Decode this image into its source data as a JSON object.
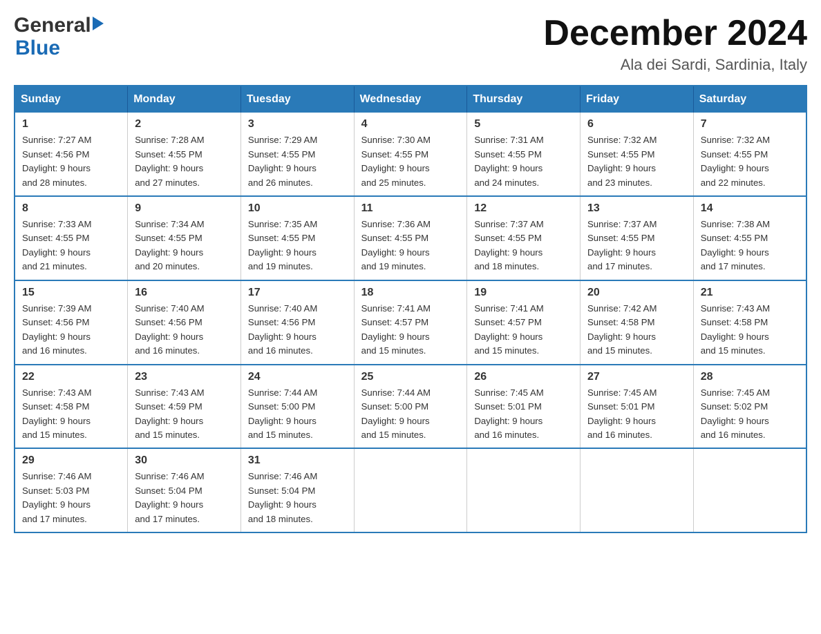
{
  "logo": {
    "general": "General",
    "blue": "Blue"
  },
  "title": "December 2024",
  "location": "Ala dei Sardi, Sardinia, Italy",
  "days_of_week": [
    "Sunday",
    "Monday",
    "Tuesday",
    "Wednesday",
    "Thursday",
    "Friday",
    "Saturday"
  ],
  "weeks": [
    [
      {
        "day": "1",
        "sunrise": "7:27 AM",
        "sunset": "4:56 PM",
        "daylight": "9 hours and 28 minutes."
      },
      {
        "day": "2",
        "sunrise": "7:28 AM",
        "sunset": "4:55 PM",
        "daylight": "9 hours and 27 minutes."
      },
      {
        "day": "3",
        "sunrise": "7:29 AM",
        "sunset": "4:55 PM",
        "daylight": "9 hours and 26 minutes."
      },
      {
        "day": "4",
        "sunrise": "7:30 AM",
        "sunset": "4:55 PM",
        "daylight": "9 hours and 25 minutes."
      },
      {
        "day": "5",
        "sunrise": "7:31 AM",
        "sunset": "4:55 PM",
        "daylight": "9 hours and 24 minutes."
      },
      {
        "day": "6",
        "sunrise": "7:32 AM",
        "sunset": "4:55 PM",
        "daylight": "9 hours and 23 minutes."
      },
      {
        "day": "7",
        "sunrise": "7:32 AM",
        "sunset": "4:55 PM",
        "daylight": "9 hours and 22 minutes."
      }
    ],
    [
      {
        "day": "8",
        "sunrise": "7:33 AM",
        "sunset": "4:55 PM",
        "daylight": "9 hours and 21 minutes."
      },
      {
        "day": "9",
        "sunrise": "7:34 AM",
        "sunset": "4:55 PM",
        "daylight": "9 hours and 20 minutes."
      },
      {
        "day": "10",
        "sunrise": "7:35 AM",
        "sunset": "4:55 PM",
        "daylight": "9 hours and 19 minutes."
      },
      {
        "day": "11",
        "sunrise": "7:36 AM",
        "sunset": "4:55 PM",
        "daylight": "9 hours and 19 minutes."
      },
      {
        "day": "12",
        "sunrise": "7:37 AM",
        "sunset": "4:55 PM",
        "daylight": "9 hours and 18 minutes."
      },
      {
        "day": "13",
        "sunrise": "7:37 AM",
        "sunset": "4:55 PM",
        "daylight": "9 hours and 17 minutes."
      },
      {
        "day": "14",
        "sunrise": "7:38 AM",
        "sunset": "4:55 PM",
        "daylight": "9 hours and 17 minutes."
      }
    ],
    [
      {
        "day": "15",
        "sunrise": "7:39 AM",
        "sunset": "4:56 PM",
        "daylight": "9 hours and 16 minutes."
      },
      {
        "day": "16",
        "sunrise": "7:40 AM",
        "sunset": "4:56 PM",
        "daylight": "9 hours and 16 minutes."
      },
      {
        "day": "17",
        "sunrise": "7:40 AM",
        "sunset": "4:56 PM",
        "daylight": "9 hours and 16 minutes."
      },
      {
        "day": "18",
        "sunrise": "7:41 AM",
        "sunset": "4:57 PM",
        "daylight": "9 hours and 15 minutes."
      },
      {
        "day": "19",
        "sunrise": "7:41 AM",
        "sunset": "4:57 PM",
        "daylight": "9 hours and 15 minutes."
      },
      {
        "day": "20",
        "sunrise": "7:42 AM",
        "sunset": "4:58 PM",
        "daylight": "9 hours and 15 minutes."
      },
      {
        "day": "21",
        "sunrise": "7:43 AM",
        "sunset": "4:58 PM",
        "daylight": "9 hours and 15 minutes."
      }
    ],
    [
      {
        "day": "22",
        "sunrise": "7:43 AM",
        "sunset": "4:58 PM",
        "daylight": "9 hours and 15 minutes."
      },
      {
        "day": "23",
        "sunrise": "7:43 AM",
        "sunset": "4:59 PM",
        "daylight": "9 hours and 15 minutes."
      },
      {
        "day": "24",
        "sunrise": "7:44 AM",
        "sunset": "5:00 PM",
        "daylight": "9 hours and 15 minutes."
      },
      {
        "day": "25",
        "sunrise": "7:44 AM",
        "sunset": "5:00 PM",
        "daylight": "9 hours and 15 minutes."
      },
      {
        "day": "26",
        "sunrise": "7:45 AM",
        "sunset": "5:01 PM",
        "daylight": "9 hours and 16 minutes."
      },
      {
        "day": "27",
        "sunrise": "7:45 AM",
        "sunset": "5:01 PM",
        "daylight": "9 hours and 16 minutes."
      },
      {
        "day": "28",
        "sunrise": "7:45 AM",
        "sunset": "5:02 PM",
        "daylight": "9 hours and 16 minutes."
      }
    ],
    [
      {
        "day": "29",
        "sunrise": "7:46 AM",
        "sunset": "5:03 PM",
        "daylight": "9 hours and 17 minutes."
      },
      {
        "day": "30",
        "sunrise": "7:46 AM",
        "sunset": "5:04 PM",
        "daylight": "9 hours and 17 minutes."
      },
      {
        "day": "31",
        "sunrise": "7:46 AM",
        "sunset": "5:04 PM",
        "daylight": "9 hours and 18 minutes."
      },
      null,
      null,
      null,
      null
    ]
  ],
  "labels": {
    "sunrise": "Sunrise:",
    "sunset": "Sunset:",
    "daylight": "Daylight:"
  }
}
